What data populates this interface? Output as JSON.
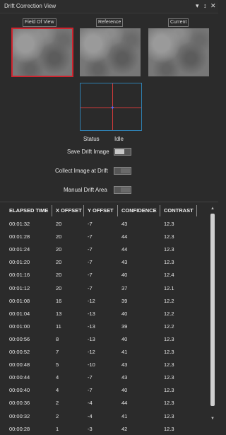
{
  "window": {
    "title": "Drift Correction View",
    "buttons": [
      "▾",
      "↕",
      "✕"
    ]
  },
  "images": {
    "field_of_view": "Field Of View",
    "reference": "Reference",
    "current": "Current"
  },
  "status": {
    "label": "Status",
    "value": "Idle"
  },
  "options": {
    "save_drift_image": {
      "label": "Save Drift Image",
      "on": true
    },
    "collect_image_at_drift": {
      "label": "Collect Image at Drift",
      "on": false
    },
    "manual_drift_area": {
      "label": "Manual Drift Area",
      "on": false
    }
  },
  "table": {
    "headers": [
      "ELAPSED TIME",
      "X OFFSET",
      "Y OFFSET",
      "CONFIDENCE",
      "CONTRAST"
    ],
    "rows": [
      [
        "00:01:32",
        "20",
        "-7",
        "43",
        "12.3"
      ],
      [
        "00:01:28",
        "20",
        "-7",
        "44",
        "12.3"
      ],
      [
        "00:01:24",
        "20",
        "-7",
        "44",
        "12.3"
      ],
      [
        "00:01:20",
        "20",
        "-7",
        "43",
        "12.3"
      ],
      [
        "00:01:16",
        "20",
        "-7",
        "40",
        "12.4"
      ],
      [
        "00:01:12",
        "20",
        "-7",
        "37",
        "12.1"
      ],
      [
        "00:01:08",
        "16",
        "-12",
        "39",
        "12.2"
      ],
      [
        "00:01:04",
        "13",
        "-13",
        "40",
        "12.2"
      ],
      [
        "00:01:00",
        "11",
        "-13",
        "39",
        "12.2"
      ],
      [
        "00:00:56",
        "8",
        "-13",
        "40",
        "12.3"
      ],
      [
        "00:00:52",
        "7",
        "-12",
        "41",
        "12.3"
      ],
      [
        "00:00:48",
        "5",
        "-10",
        "43",
        "12.3"
      ],
      [
        "00:00:44",
        "4",
        "-7",
        "43",
        "12.3"
      ],
      [
        "00:00:40",
        "4",
        "-7",
        "40",
        "12.3"
      ],
      [
        "00:00:36",
        "2",
        "-4",
        "44",
        "12.3"
      ],
      [
        "00:00:32",
        "2",
        "-4",
        "41",
        "12.3"
      ],
      [
        "00:00:28",
        "1",
        "-3",
        "42",
        "12.3"
      ]
    ]
  },
  "colors": {
    "background": "#2b2b2b",
    "selected_outline": "#d0252f",
    "crosshair": "#d43a3a",
    "crosshair_frame": "#2f7fb0",
    "marker": "#4d6bff"
  }
}
